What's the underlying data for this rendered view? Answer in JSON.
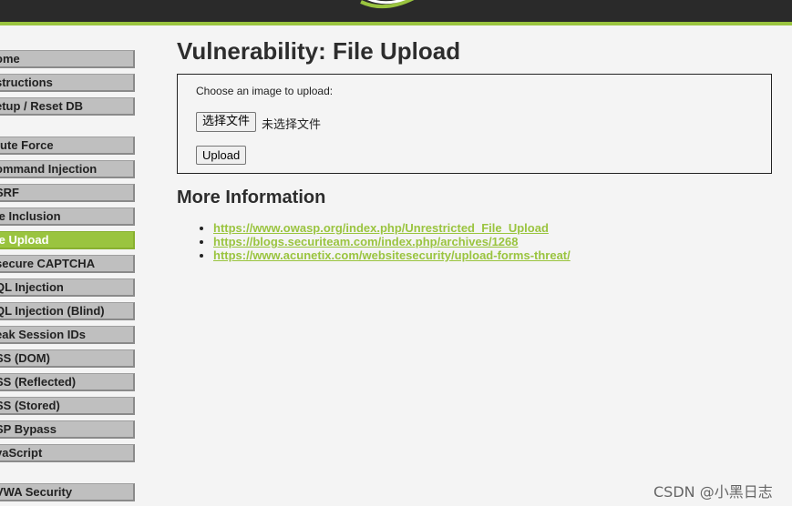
{
  "sidebar": {
    "items": [
      {
        "label": "ome"
      },
      {
        "label": "structions"
      },
      {
        "label": "etup / Reset DB"
      },
      {
        "label": "rute Force"
      },
      {
        "label": "ommand Injection"
      },
      {
        "label": "SRF"
      },
      {
        "label": "le Inclusion"
      },
      {
        "label": "le Upload"
      },
      {
        "label": "secure CAPTCHA"
      },
      {
        "label": "QL Injection"
      },
      {
        "label": "QL Injection (Blind)"
      },
      {
        "label": "eak Session IDs"
      },
      {
        "label": "SS (DOM)"
      },
      {
        "label": "SS (Reflected)"
      },
      {
        "label": "SS (Stored)"
      },
      {
        "label": "SP Bypass"
      },
      {
        "label": "vaScript"
      },
      {
        "label": "VWA Security"
      }
    ],
    "selected": "le Upload"
  },
  "main": {
    "title": "Vulnerability: File Upload",
    "upload": {
      "label": "Choose an image to upload:",
      "file_button": "选择文件",
      "file_status": "未选择文件",
      "submit": "Upload"
    },
    "more_info": {
      "heading": "More Information",
      "links": [
        "https://www.owasp.org/index.php/Unrestricted_File_Upload",
        "https://blogs.securiteam.com/index.php/archives/1268",
        "https://www.acunetix.com/websitesecurity/upload-forms-threat/"
      ]
    }
  },
  "watermark": "CSDN @小黑日志",
  "colors": {
    "accent": "#9ac43f",
    "header": "#2a2a2a",
    "background": "#f4f4f4",
    "menu": "#bfbfbf"
  }
}
